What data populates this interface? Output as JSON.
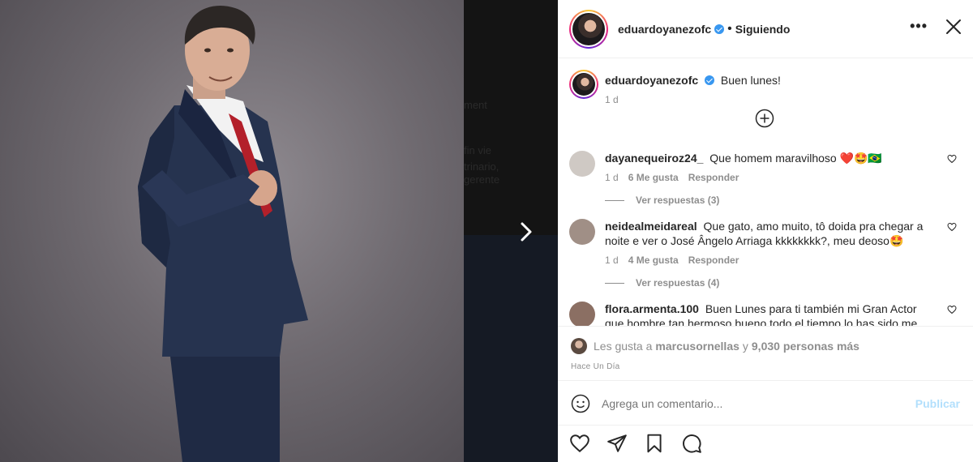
{
  "post": {
    "username": "eduardoyanezofc",
    "follow_state": "Siguiendo",
    "caption": "Buen lunes!",
    "caption_time": "1 d"
  },
  "comments": [
    {
      "username": "dayanequeiroz24_",
      "text": "Que homem maravilhoso ❤️🤩🇧🇷",
      "time": "1 d",
      "likes": "6 Me gusta",
      "reply": "Responder",
      "view_replies": "Ver respuestas (3)",
      "avatar_color": "#cfc9c4"
    },
    {
      "username": "neidealmeidareal",
      "text": "Que gato, amo muito, tô doida pra chegar a noite e ver o José Ângelo Arriaga kkkkkkkk?, meu deoso🤩",
      "time": "1 d",
      "likes": "4 Me gusta",
      "reply": "Responder",
      "view_replies": "Ver respuestas (4)",
      "avatar_color": "#a08f86"
    },
    {
      "username": "flora.armenta.100",
      "text": "Buen Lunes para ti también mi Gran Actor que hombre tan hermoso bueno todo el tiempo lo has sido me encanta",
      "avatar_color": "#8b6f63"
    }
  ],
  "likes": {
    "prefix": "Les gusta a",
    "user": "marcusornellas",
    "suffix": "y",
    "count": "9,030 personas más"
  },
  "timestamp": "Hace Un Día",
  "composer": {
    "placeholder": "Agrega un comentario...",
    "publish": "Publicar"
  },
  "icons": {
    "more": "more-options-icon",
    "close": "close-icon",
    "next": "chevron-right-icon",
    "add": "plus-circle-icon",
    "emoji": "emoji-icon",
    "like": "heart-icon",
    "share": "paper-plane-icon",
    "save": "bookmark-icon",
    "comment": "comment-icon"
  },
  "colors": {
    "verified": "#3897f0",
    "publish_disabled": "#b2dffc",
    "heart_red": "#ed4956"
  }
}
